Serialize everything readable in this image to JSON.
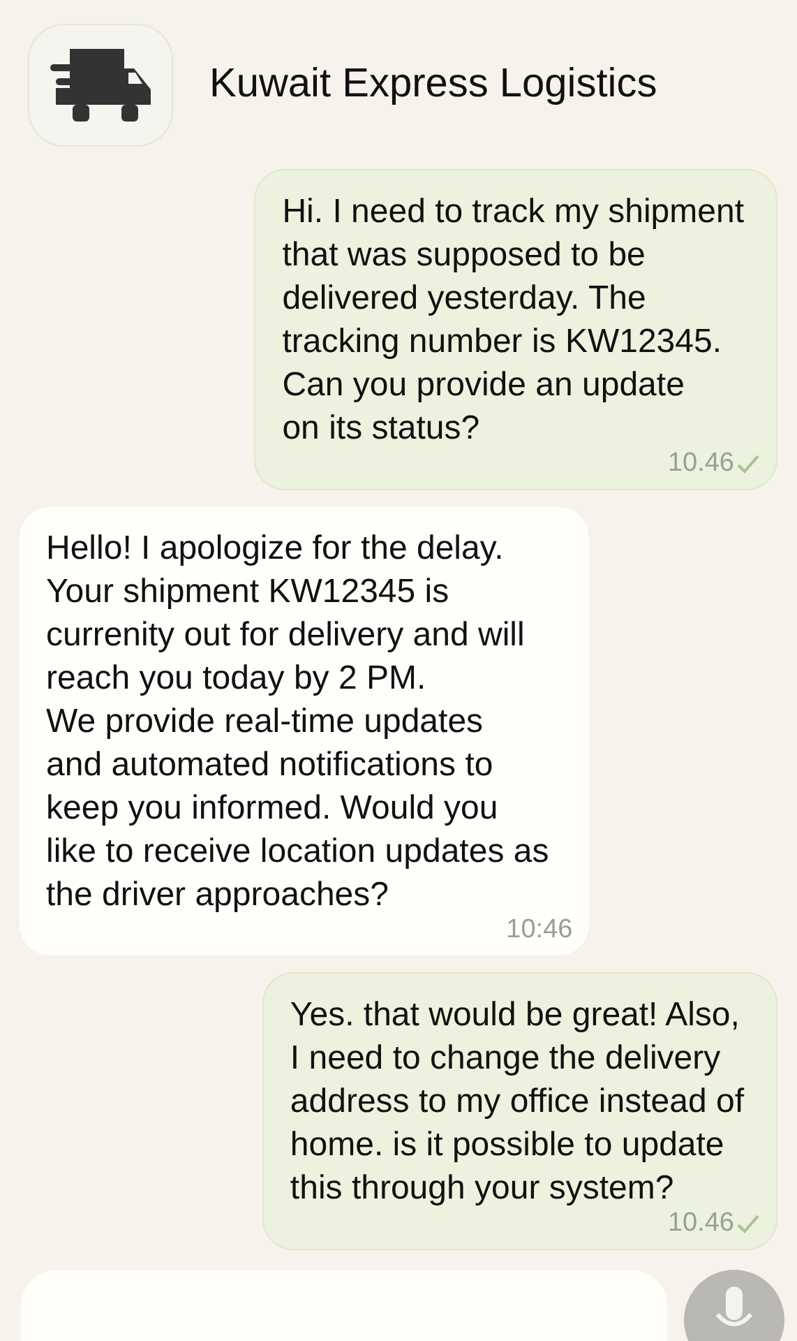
{
  "header": {
    "title": "Kuwait Express Logistics"
  },
  "messages": [
    {
      "kind": "sent",
      "lines": [
        "Hi. I need to track my shipment",
        "that was supposed to be",
        "delivered yesterday. The",
        "tracking number is KW12345.",
        "Can you provide an update",
        "on its status?"
      ],
      "time": "10.46",
      "tick": true
    },
    {
      "kind": "received",
      "lines": [
        "Hello! I apologize for the delay.",
        "Your shipment KW12345 is",
        "currenity out for delivery and will",
        "reach you today by 2 PM.",
        "We provide real-time updates",
        "and automated notifications to",
        "keep you informed. Would you",
        "like to receive location updates  as",
        "the driver approaches?"
      ],
      "time": "10:46",
      "tick": false
    },
    {
      "kind": "sent",
      "lines": [
        "Yes. that would be great! Also,",
        "I need to change the delivery",
        "address to my office instead of",
        "home. is it possible to update",
        "this through your system?"
      ],
      "time": "10.46",
      "tick": true
    }
  ]
}
